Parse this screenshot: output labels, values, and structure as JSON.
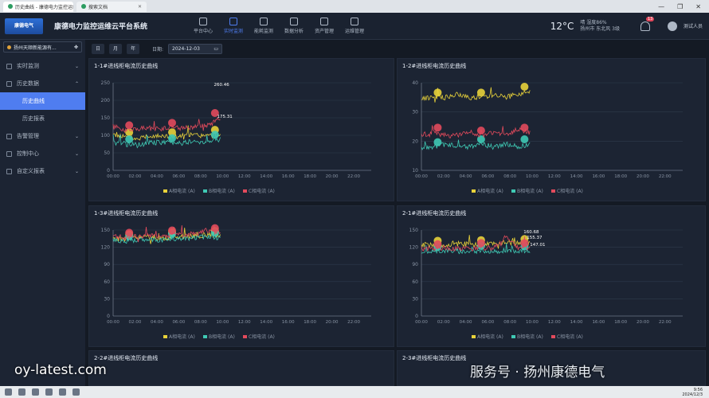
{
  "browser": {
    "tabs": [
      {
        "label": "历史曲线 - 康德电力监控运维",
        "active": true
      },
      {
        "label": "搜索文档",
        "active": false
      }
    ],
    "win_buttons": [
      "—",
      "❐",
      "✕"
    ]
  },
  "app": {
    "logo_text": "康德电气",
    "title": "康德电力监控运维云平台系统",
    "nav": [
      {
        "label": "平台中心",
        "active": false
      },
      {
        "label": "实时监测",
        "active": true
      },
      {
        "label": "能耗监测",
        "active": false
      },
      {
        "label": "数据分析",
        "active": false
      },
      {
        "label": "资产管理",
        "active": false
      },
      {
        "label": "运维管理",
        "active": false
      }
    ],
    "weather": {
      "temp": "12°C",
      "desc1": "晴 湿度86%",
      "desc2": "扬州市 东北风 3级"
    },
    "notif_count": "13",
    "user": "测试人员"
  },
  "sidebar": {
    "site": "扬州天顺新能源有...",
    "menu": [
      {
        "label": "实时监测",
        "type": "group"
      },
      {
        "label": "历史数据",
        "type": "group"
      },
      {
        "label": "历史曲线",
        "type": "sub",
        "active": true
      },
      {
        "label": "历史报表",
        "type": "sub"
      },
      {
        "label": "告警管理",
        "type": "group"
      },
      {
        "label": "控制中心",
        "type": "group"
      },
      {
        "label": "自定义报表",
        "type": "group"
      }
    ]
  },
  "toolbar": {
    "buttons": [
      {
        "label": "日",
        "active": true
      },
      {
        "label": "月",
        "active": false
      },
      {
        "label": "年",
        "active": false
      }
    ],
    "date_label": "日期:",
    "date_value": "2024-12-03"
  },
  "colors": {
    "a": "#e8d23a",
    "b": "#3fc9b4",
    "c": "#e24a5c",
    "grid": "#2e3a4c",
    "axis": "#8893a3"
  },
  "charts": [
    {
      "title": "1-1#进线柜电流历史曲线",
      "ytick_labels": [
        "0",
        "50",
        "100",
        "150",
        "200",
        "250"
      ],
      "ymax": 250
    },
    {
      "title": "1-2#进线柜电流历史曲线",
      "ytick_labels": [
        "10",
        "20",
        "30",
        "40"
      ],
      "ymin": 10,
      "ymax": 40
    },
    {
      "title": "1-3#进线柜电流历史曲线",
      "ytick_labels": [
        "0",
        "30",
        "60",
        "90",
        "120",
        "150"
      ],
      "ymax": 150
    },
    {
      "title": "2-1#进线柜电流历史曲线",
      "ytick_labels": [
        "0",
        "30",
        "60",
        "90",
        "120",
        "150"
      ],
      "ymax": 150
    },
    {
      "title": "2-2#进线柜电流历史曲线"
    },
    {
      "title": "2-3#进线柜电流历史曲线"
    }
  ],
  "xlabels": [
    "00:00",
    "02:00",
    "04:00",
    "06:00",
    "08:00",
    "10:00",
    "12:00",
    "14:00",
    "16:00",
    "18:00",
    "20:00",
    "22:00"
  ],
  "legend": [
    "A相电流 (A)",
    "B相电流 (A)",
    "C相电流 (A)"
  ],
  "chart_data": [
    {
      "type": "line",
      "title": "1-1#进线柜电流历史曲线",
      "x_range": [
        "00:00",
        "22:00"
      ],
      "ylim": [
        0,
        250
      ],
      "series": [
        {
          "name": "A相电流 (A)",
          "values": [
            105,
            95,
            90,
            100,
            98,
            95,
            100,
            100,
            98,
            102
          ]
        },
        {
          "name": "B相电流 (A)",
          "values": [
            80,
            75,
            72,
            78,
            80,
            78,
            82,
            80,
            85,
            88
          ]
        },
        {
          "name": "C相电流 (A)",
          "values": [
            125,
            115,
            120,
            120,
            118,
            122,
            120,
            125,
            128,
            150
          ]
        }
      ],
      "annotations": [
        "260.46",
        "175.31"
      ]
    },
    {
      "type": "line",
      "title": "1-2#进线柜电流历史曲线",
      "x_range": [
        "00:00",
        "22:00"
      ],
      "ylim": [
        10,
        40
      ],
      "series": [
        {
          "name": "A相电流 (A)",
          "values": [
            35,
            35,
            35,
            36,
            35,
            35,
            36,
            35,
            36,
            37
          ]
        },
        {
          "name": "B相电流 (A)",
          "values": [
            18,
            18,
            19,
            18,
            18,
            19,
            18,
            19,
            18,
            19
          ]
        },
        {
          "name": "C相电流 (A)",
          "values": [
            22,
            23,
            22,
            22,
            23,
            22,
            23,
            22,
            24,
            23
          ]
        }
      ]
    },
    {
      "type": "line",
      "title": "1-3#进线柜电流历史曲线",
      "x_range": [
        "00:00",
        "22:00"
      ],
      "ylim": [
        0,
        150
      ],
      "series": [
        {
          "name": "A相电流 (A)",
          "values": [
            135,
            134,
            136,
            137,
            136,
            138,
            139,
            140,
            141,
            140
          ]
        },
        {
          "name": "B相电流 (A)",
          "values": [
            132,
            131,
            133,
            134,
            133,
            135,
            136,
            137,
            138,
            137
          ]
        },
        {
          "name": "C相电流 (A)",
          "values": [
            138,
            137,
            139,
            140,
            139,
            141,
            142,
            143,
            150,
            145
          ]
        }
      ]
    },
    {
      "type": "line",
      "title": "2-1#进线柜电流历史曲线",
      "x_range": [
        "00:00",
        "22:00"
      ],
      "ylim": [
        0,
        150
      ],
      "series": [
        {
          "name": "A相电流 (A)",
          "values": [
            125,
            123,
            124,
            126,
            125,
            124,
            126,
            128,
            127,
            126
          ]
        },
        {
          "name": "B相电流 (A)",
          "values": [
            113,
            112,
            114,
            113,
            112,
            114,
            113,
            115,
            114,
            113
          ]
        },
        {
          "name": "C相电流 (A)",
          "values": [
            118,
            117,
            119,
            118,
            117,
            119,
            118,
            140,
            120,
            119
          ]
        }
      ],
      "annotations": [
        "160.68",
        "155.37",
        "147.01"
      ]
    }
  ],
  "watermarks": {
    "left": "oy-latest.com",
    "right": "服务号 · 扬州康德电气"
  },
  "taskbar": {
    "time": "9:56",
    "date": "2024/12/3"
  }
}
